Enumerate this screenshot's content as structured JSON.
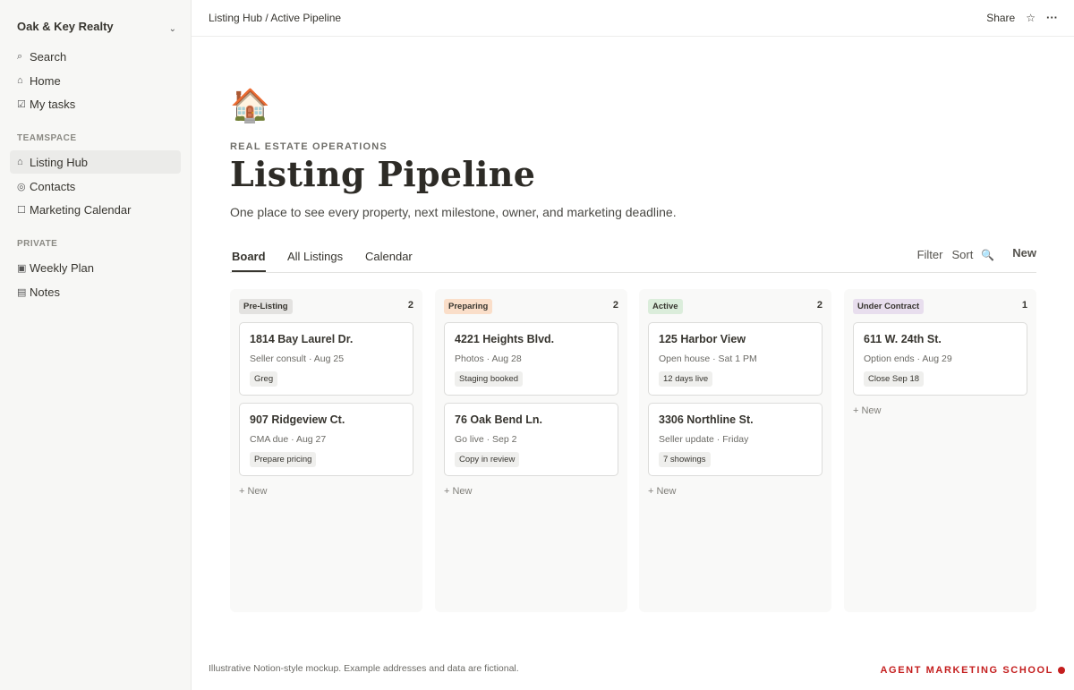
{
  "sidebar": {
    "workspace": "Oak & Key Realty",
    "items": [
      {
        "icon": "⌕",
        "label": "Search"
      },
      {
        "icon": "⌂",
        "label": "Home"
      },
      {
        "icon": "☑",
        "label": "My tasks"
      }
    ],
    "teamspace_label": "TEAMSPACE",
    "teamspace_items": [
      {
        "icon": "⌂",
        "label": "Listing Hub"
      },
      {
        "icon": "◎",
        "label": "Contacts"
      },
      {
        "icon": "☐",
        "label": "Marketing Calendar"
      }
    ],
    "private_label": "PRIVATE",
    "private_items": [
      {
        "icon": "▣",
        "label": "Weekly Plan"
      },
      {
        "icon": "▤",
        "label": "Notes"
      }
    ]
  },
  "topbar": {
    "breadcrumb": "Listing Hub / Active Pipeline",
    "share": "Share",
    "star_icon": "☆",
    "more_icon": "···"
  },
  "page": {
    "icon": "🏠",
    "eyebrow": "REAL ESTATE OPERATIONS",
    "title": "Listing Pipeline",
    "description": "One place to see every property, next milestone, owner, and marketing deadline."
  },
  "tabs": [
    "Board",
    "All Listings",
    "Calendar"
  ],
  "toolbar": {
    "filter": "Filter",
    "sort": "Sort",
    "search_icon": "🔍",
    "new": "New"
  },
  "columns": [
    {
      "name": "Pre-Listing",
      "count": "2",
      "color": "#e3e2e0",
      "cards": [
        {
          "title": "1814 Bay Laurel Dr.",
          "sub": "Seller consult · Aug 25",
          "chip": "Greg"
        },
        {
          "title": "907 Ridgeview Ct.",
          "sub": "CMA due · Aug 27",
          "chip": "Prepare pricing"
        }
      ],
      "new": "+ New"
    },
    {
      "name": "Preparing",
      "count": "2",
      "color": "#fadec9",
      "cards": [
        {
          "title": "4221 Heights Blvd.",
          "sub": "Photos · Aug 28",
          "chip": "Staging booked"
        },
        {
          "title": "76 Oak Bend Ln.",
          "sub": "Go live · Sep 2",
          "chip": "Copy in review"
        }
      ],
      "new": "+ New"
    },
    {
      "name": "Active",
      "count": "2",
      "color": "#dbeddb",
      "cards": [
        {
          "title": "125 Harbor View",
          "sub": "Open house · Sat 1 PM",
          "chip": "12 days live"
        },
        {
          "title": "3306 Northline St.",
          "sub": "Seller update · Friday",
          "chip": "7 showings"
        }
      ],
      "new": "+ New"
    },
    {
      "name": "Under Contract",
      "count": "1",
      "color": "#e8deee",
      "cards": [
        {
          "title": "611 W. 24th St.",
          "sub": "Option ends · Aug 29",
          "chip": "Close Sep 18"
        }
      ],
      "new": "+ New"
    }
  ],
  "footer": {
    "note": "Illustrative Notion-style mockup. Example addresses and data are fictional.",
    "brand": "AGENT MARKETING SCHOOL",
    "brand_color": "#c41e1e"
  }
}
